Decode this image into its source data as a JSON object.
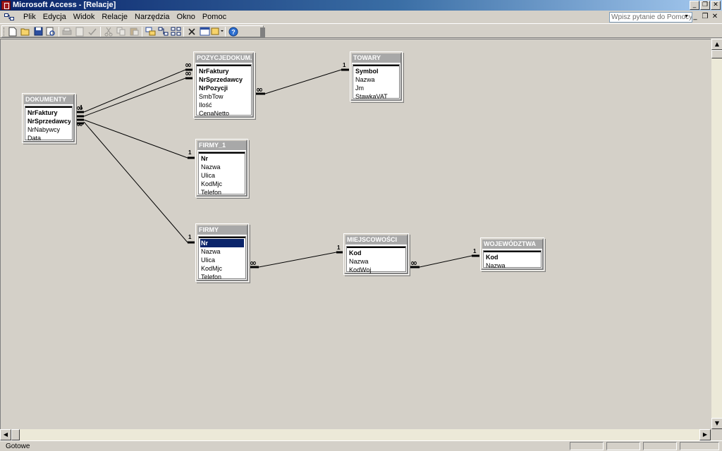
{
  "window": {
    "title": "Microsoft Access - [Relacje]"
  },
  "menu": {
    "items": [
      "Plik",
      "Edycja",
      "Widok",
      "Relacje",
      "Narzędzia",
      "Okno",
      "Pomoc"
    ],
    "help_placeholder": "Wpisz pytanie do Pomocy"
  },
  "toolbar": {
    "buttons": [
      "new-icon",
      "open-icon",
      "save-icon",
      "print-preview-icon",
      "print-icon",
      "preview-icon",
      "spell-icon",
      "cut-icon",
      "copy-icon",
      "paste-icon",
      "show-table-icon",
      "show-direct-icon",
      "show-all-icon",
      "delete-icon",
      "new-object-icon",
      "database-window-icon",
      "help-icon"
    ]
  },
  "tables": {
    "dokumenty": {
      "title": "DOKUMENTY",
      "fields": [
        "NrFaktury",
        "NrSprzedawcy",
        "NrNabywcy",
        "Data"
      ]
    },
    "pozycje": {
      "title": "POZYCJEDOKUM...",
      "fields": [
        "NrFaktury",
        "NrSprzedawcy",
        "NrPozycji",
        "SmbTow",
        "Ilość",
        "CenaNetto"
      ]
    },
    "towary": {
      "title": "TOWARY",
      "fields": [
        "Symbol",
        "Nazwa",
        "Jm",
        "StawkaVAT"
      ]
    },
    "firmy1": {
      "title": "FIRMY_1",
      "fields": [
        "Nr",
        "Nazwa",
        "Ulica",
        "KodMjc",
        "Telefon"
      ]
    },
    "firmy": {
      "title": "FIRMY",
      "fields": [
        "Nr",
        "Nazwa",
        "Ulica",
        "KodMjc",
        "Telefon"
      ]
    },
    "miejscowosci": {
      "title": "MIEJSCOWOŚCI",
      "fields": [
        "Kod",
        "Nazwa",
        "KodWoj"
      ]
    },
    "wojewodztwa": {
      "title": "WOJEWÓDZTWA",
      "fields": [
        "Kod",
        "Nazwa"
      ]
    }
  },
  "relations": {
    "one_label": "1",
    "many_label": "∞"
  },
  "status": {
    "text": "Gotowe"
  }
}
